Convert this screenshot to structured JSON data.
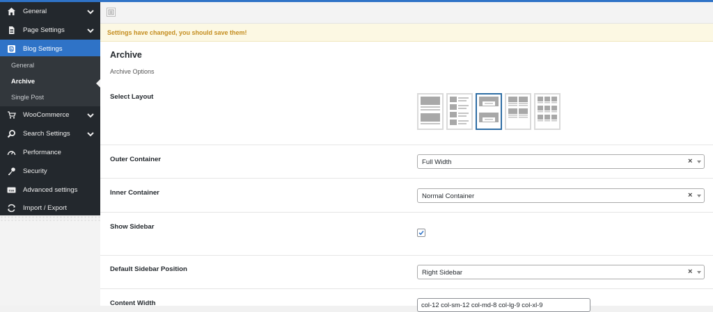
{
  "sidebar": {
    "items": [
      {
        "label": "General",
        "icon": "home-icon"
      },
      {
        "label": "Page Settings",
        "icon": "page-icon"
      },
      {
        "label": "Blog Settings",
        "icon": "blog-icon"
      },
      {
        "label": "WooCommerce",
        "icon": "cart-icon"
      },
      {
        "label": "Search Settings",
        "icon": "search-icon"
      },
      {
        "label": "Performance",
        "icon": "gauge-icon"
      },
      {
        "label": "Security",
        "icon": "key-icon"
      },
      {
        "label": "Advanced settings",
        "icon": "css-icon"
      },
      {
        "label": "Import / Export",
        "icon": "refresh-icon"
      }
    ],
    "subitems": [
      {
        "label": "General"
      },
      {
        "label": "Archive"
      },
      {
        "label": "Single Post"
      }
    ]
  },
  "notice": "Settings have changed, you should save them!",
  "section": {
    "title": "Archive",
    "description": "Archive Options"
  },
  "fields": {
    "select_layout": {
      "label": "Select Layout"
    },
    "outer_container": {
      "label": "Outer Container",
      "value": "Full Width"
    },
    "inner_container": {
      "label": "Inner Container",
      "value": "Normal Container"
    },
    "show_sidebar": {
      "label": "Show Sidebar",
      "checked": true
    },
    "sidebar_position": {
      "label": "Default Sidebar Position",
      "value": "Right Sidebar"
    },
    "content_width": {
      "label": "Content Width",
      "value": "col-12 col-sm-12 col-md-8 col-lg-9 col-xl-9"
    }
  },
  "colors": {
    "accent": "#2f73c7",
    "sidebar_bg": "#23282d",
    "notice_text": "#c48d1f"
  }
}
